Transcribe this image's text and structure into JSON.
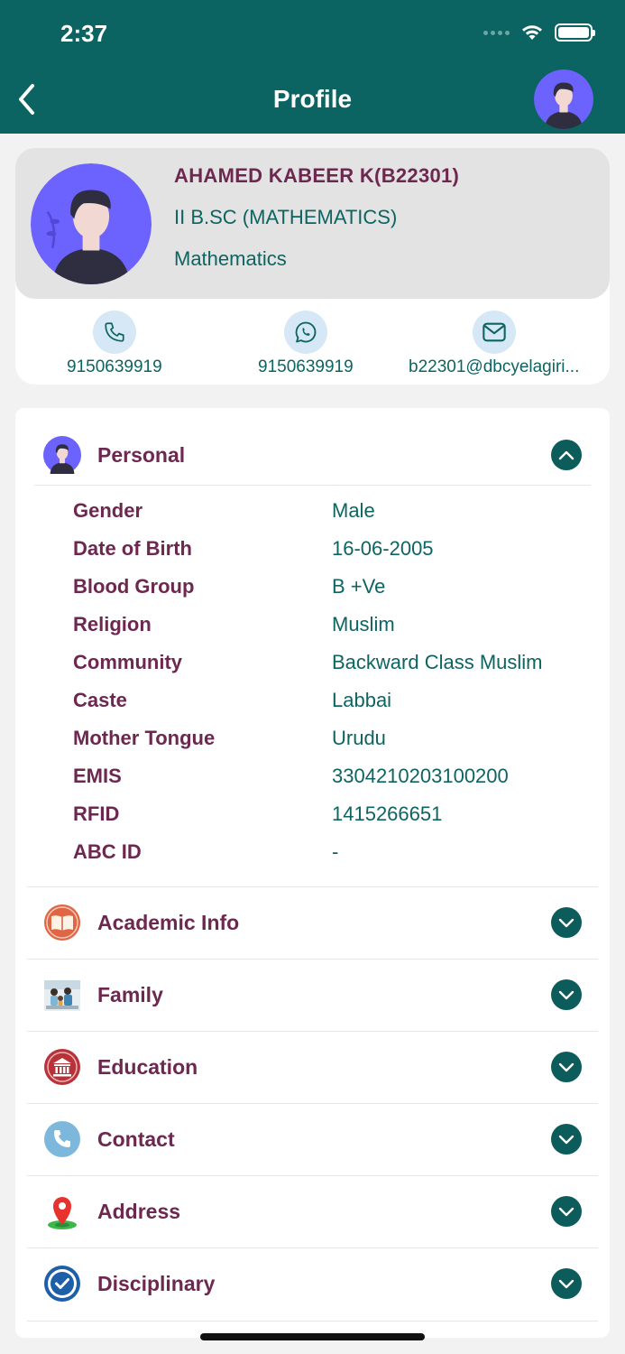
{
  "status_bar": {
    "time": "2:37"
  },
  "header": {
    "title": "Profile"
  },
  "profile": {
    "name": "AHAMED KABEER K(B22301)",
    "course": "II B.SC (MATHEMATICS)",
    "department": "Mathematics",
    "phone": "9150639919",
    "whatsapp": "9150639919",
    "email": "b22301@dbcyelagiri..."
  },
  "sections": {
    "personal": "Personal",
    "academic": "Academic Info",
    "family": "Family",
    "education": "Education",
    "contact": "Contact",
    "address": "Address",
    "disciplinary": "Disciplinary"
  },
  "personal_info": [
    {
      "label": "Gender",
      "value": "Male"
    },
    {
      "label": "Date of Birth",
      "value": "16-06-2005"
    },
    {
      "label": "Blood Group",
      "value": "B +Ve"
    },
    {
      "label": "Religion",
      "value": "Muslim"
    },
    {
      "label": "Community",
      "value": "Backward Class Muslim"
    },
    {
      "label": "Caste",
      "value": "Labbai"
    },
    {
      "label": "Mother Tongue",
      "value": "Urudu"
    },
    {
      "label": "EMIS",
      "value": "3304210203100200"
    },
    {
      "label": "RFID",
      "value": "1415266651"
    },
    {
      "label": "ABC ID",
      "value": "-"
    }
  ],
  "colors": {
    "header_bg": "#0b6461",
    "label": "#6d2850",
    "value": "#0d6461",
    "avatar_bg": "#6c63ff"
  }
}
